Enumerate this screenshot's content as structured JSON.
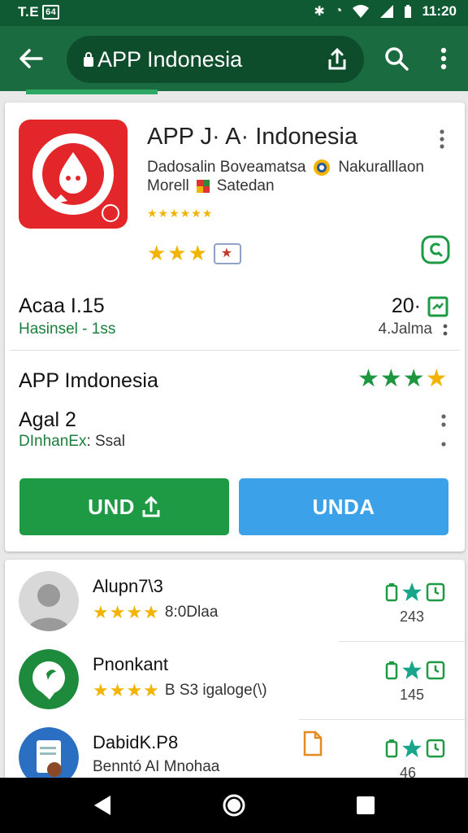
{
  "status_bar": {
    "left_text": "T.E",
    "left_box": "64",
    "time": "11:20"
  },
  "toolbar": {
    "search_text": "APP Indonesia"
  },
  "app": {
    "title": "APP J· A· Indonesia",
    "developer": "Dadosalin Boveamatsa",
    "category": "Nakuralllaon",
    "line2_a": "Morell",
    "line2_b": "Satedan",
    "mini_stars": "★★★★★★",
    "big_stars": "★★★",
    "badge": "★"
  },
  "stats": {
    "left_title": "Acaa I.15",
    "left_sub": "Hasinsel - 1ss",
    "right_title": "20·",
    "right_sub": "4.Jalma"
  },
  "row2": {
    "title": "APP Imdonesia",
    "stars_green": "★★★",
    "stars_yellow": "★"
  },
  "row3": {
    "title": "Agal 2",
    "sub_green": "DInhanEx",
    "sub_rest": ": Ssal"
  },
  "buttons": {
    "install_label": "UND",
    "open_label": "UNDA"
  },
  "list": [
    {
      "title": "Alupn7\\3",
      "stars": "★★★★",
      "meta": "8:0Dlaa",
      "count": "243"
    },
    {
      "title": "Pnonkant",
      "stars": "★★★★",
      "meta": "B S3 igaloge(\\)",
      "count": "145"
    },
    {
      "title": "DabidK.P8",
      "meta": "Benntó AI Mnohaa",
      "count": "46"
    }
  ],
  "colors": {
    "toolbar": "#1a6b40",
    "status": "#0f5a33",
    "install": "#1e9a45",
    "open": "#3ba2ea",
    "star": "#f2b400",
    "icon_bg": "#e3262a"
  }
}
